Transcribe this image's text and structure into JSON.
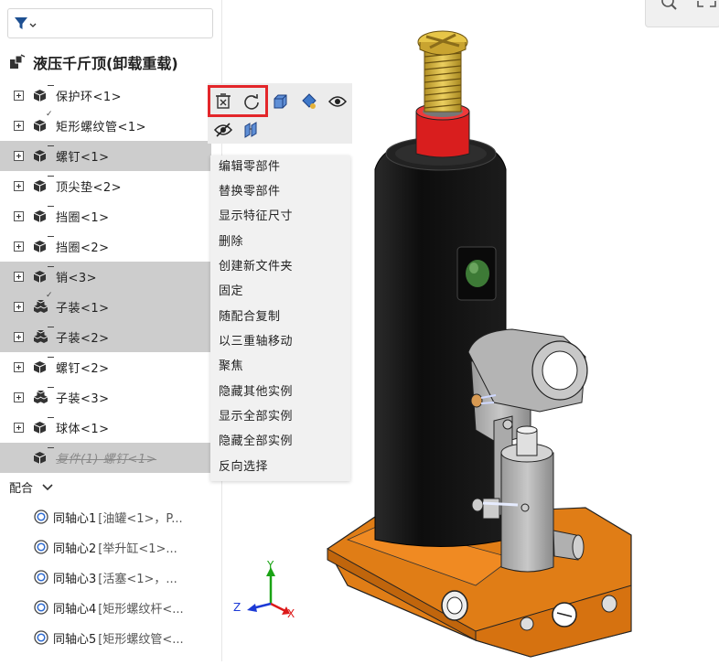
{
  "tree": {
    "assembly_title": "液压千斤顶(卸载重载)",
    "items": [
      {
        "label": "保护环<1>",
        "type": "part",
        "selected": false,
        "checked": false
      },
      {
        "label": "矩形螺纹管<1>",
        "type": "part",
        "selected": false,
        "checked": true
      },
      {
        "label": "螺钉<1>",
        "type": "part",
        "selected": true,
        "checked": false
      },
      {
        "label": "顶尖垫<2>",
        "type": "part",
        "selected": false,
        "checked": false
      },
      {
        "label": "挡圈<1>",
        "type": "part",
        "selected": false,
        "checked": false
      },
      {
        "label": "挡圈<2>",
        "type": "part",
        "selected": false,
        "checked": false
      },
      {
        "label": "销<3>",
        "type": "part",
        "selected": true,
        "checked": false
      },
      {
        "label": "子装<1>",
        "type": "subassembly",
        "selected": true,
        "checked": true
      },
      {
        "label": "子装<2>",
        "type": "subassembly",
        "selected": true,
        "checked": false
      },
      {
        "label": "螺钉<2>",
        "type": "part",
        "selected": false,
        "checked": false
      },
      {
        "label": "子装<3>",
        "type": "subassembly",
        "selected": false,
        "checked": false
      },
      {
        "label": "球体<1>",
        "type": "part",
        "selected": false,
        "checked": false
      },
      {
        "label": "复件(1) 螺钉<1>",
        "type": "part",
        "selected": true,
        "checked": false,
        "suppressed": true
      }
    ]
  },
  "mates": {
    "header": "配合",
    "items": [
      {
        "name": "同轴心1",
        "ref": "[油罐<1>，P..."
      },
      {
        "name": "同轴心2",
        "ref": "[举升缸<1>..."
      },
      {
        "name": "同轴心3",
        "ref": "[活塞<1>，..."
      },
      {
        "name": "同轴心4",
        "ref": "[矩形螺纹杆<..."
      },
      {
        "name": "同轴心5",
        "ref": "[矩形螺纹管<..."
      }
    ]
  },
  "toolbar": {
    "buttons": [
      "delete-part-icon",
      "rebuild-icon",
      "normal-to-view-icon",
      "appearance-icon",
      "show-icon",
      "hide-icon",
      "isolate-icon"
    ]
  },
  "context_menu": {
    "items": [
      "编辑零部件",
      "替换零部件",
      "显示特征尺寸",
      "删除",
      "创建新文件夹",
      "固定",
      "随配合复制",
      "以三重轴移动",
      "聚焦",
      "隐藏其他实例",
      "显示全部实例",
      "隐藏全部实例",
      "反向选择"
    ]
  },
  "triad": {
    "x_label": "X",
    "y_label": "Y",
    "z_label": "Z"
  },
  "colors": {
    "selection": "#cdcdcd",
    "highlight_box": "#e3262a",
    "base": "#e07d16",
    "body": "#161616",
    "cap": "#d91e1e",
    "screw": "#d8b73a"
  }
}
